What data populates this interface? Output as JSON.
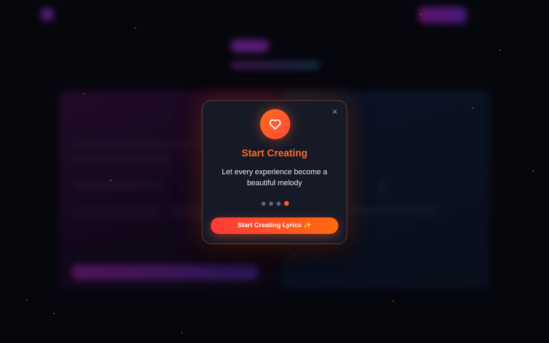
{
  "background": {
    "nav": {
      "brand": "",
      "links": [
        "",
        "",
        ""
      ],
      "cta_label": "",
      "login_label": ""
    },
    "hero": {
      "pill_active": "",
      "pill_inactive": "",
      "subtitle": ""
    },
    "left_panel": {
      "title": "",
      "label": ""
    },
    "right_panel": {
      "title": ""
    }
  },
  "modal": {
    "icon": "heart-icon",
    "title": "Start Creating",
    "body": "Let every experience become a beautiful melody",
    "steps": {
      "total": 4,
      "current": 4
    },
    "cta_label": "Start Creating Lyrics ✨",
    "close_glyph": "×"
  },
  "colors": {
    "accent": "#ff6a24",
    "cta_start": "#ff3a3a",
    "cta_end": "#ff6a10",
    "modal_bg": "#161a27"
  }
}
